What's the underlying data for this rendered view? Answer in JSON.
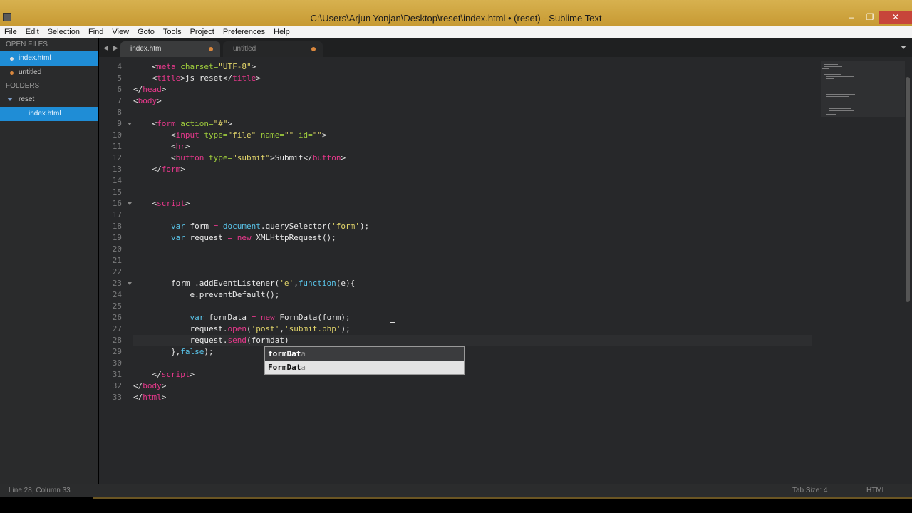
{
  "window": {
    "title": "C:\\Users\\Arjun Yonjan\\Desktop\\reset\\index.html • (reset) - Sublime Text",
    "minimize": "‒",
    "maximize": "❐",
    "close": "✕"
  },
  "menu": [
    "File",
    "Edit",
    "Selection",
    "Find",
    "View",
    "Goto",
    "Tools",
    "Project",
    "Preferences",
    "Help"
  ],
  "sidebar": {
    "open_files_header": "OPEN FILES",
    "open_files": [
      "index.html",
      "untitled"
    ],
    "folders_header": "FOLDERS",
    "folder": "reset",
    "folder_files": [
      "index.html"
    ]
  },
  "tabs": [
    "index.html",
    "untitled"
  ],
  "tab_nav": {
    "left": "◀",
    "right": "▶"
  },
  "code": {
    "line_numbers": [
      "4",
      "5",
      "6",
      "7",
      "8",
      "9",
      "10",
      "11",
      "12",
      "13",
      "14",
      "15",
      "16",
      "17",
      "18",
      "19",
      "20",
      "21",
      "22",
      "23",
      "24",
      "25",
      "26",
      "27",
      "28",
      "29",
      "30",
      "31",
      "32",
      "33"
    ],
    "l4": {
      "indent": "    ",
      "lt": "<",
      "tag": "meta",
      "attr": " charset=",
      "val": "\"UTF-8\"",
      "gt": ">"
    },
    "l5": {
      "indent": "    ",
      "lt": "<",
      "tag": "title",
      "gt": ">",
      "text": "js reset",
      "lt2": "</",
      "tag2": "title",
      "gt2": ">"
    },
    "l6": {
      "lt": "</",
      "tag": "head",
      "gt": ">"
    },
    "l7": {
      "lt": "<",
      "tag": "body",
      "gt": ">"
    },
    "l9": {
      "indent": "    ",
      "lt": "<",
      "tag": "form",
      "attr": " action=",
      "val": "\"#\"",
      "gt": ">"
    },
    "l10": {
      "indent": "        ",
      "lt": "<",
      "tag": "input",
      "attr1": " type=",
      "val1": "\"file\"",
      "attr2": " name=",
      "val2": "\"\"",
      "attr3": " id=",
      "val3": "\"\"",
      "gt": ">"
    },
    "l11": {
      "indent": "        ",
      "lt": "<",
      "tag": "hr",
      "gt": ">"
    },
    "l12": {
      "indent": "        ",
      "lt": "<",
      "tag": "button",
      "attr": " type=",
      "val": "\"submit\"",
      "gt": ">",
      "text": "Submit",
      "lt2": "</",
      "tag2": "button",
      "gt2": ">"
    },
    "l13": {
      "indent": "    ",
      "lt": "</",
      "tag": "form",
      "gt": ">"
    },
    "l16": {
      "indent": "    ",
      "lt": "<",
      "tag": "script",
      "gt": ">"
    },
    "l18": {
      "indent": "        ",
      "kw": "var",
      "a": " form ",
      "op": "=",
      "b": " ",
      "obj": "document",
      "c": ".querySelector(",
      "s": "'form'",
      "d": ");"
    },
    "l19": {
      "indent": "        ",
      "kw": "var",
      "a": " request ",
      "op": "=",
      "b": " ",
      "kw2": "new",
      "c": " ",
      "cls": "XMLHttpRequest",
      "d": "();"
    },
    "l23": {
      "indent": "        ",
      "a": "form .addEventListener(",
      "s": "'e'",
      "b": ",",
      "fn": "function",
      "c": "(e){"
    },
    "l24": {
      "indent": "            ",
      "a": "e.preventDefault();"
    },
    "l26": {
      "indent": "            ",
      "kw": "var",
      "a": " formData ",
      "op": "=",
      "b": " ",
      "kw2": "new",
      "c": " FormData(form);"
    },
    "l27": {
      "indent": "            ",
      "a": "request.",
      "m": "open",
      "b": "(",
      "s1": "'post'",
      "c": ",",
      "s2": "'submit.php'",
      "d": ");"
    },
    "l28": {
      "indent": "            ",
      "a": "request.",
      "m": "send",
      "b": "(formdat)"
    },
    "l29": {
      "indent": "        ",
      "a": "},",
      "kw": "false",
      "b": ");"
    },
    "l31": {
      "indent": "    ",
      "lt": "</",
      "tag": "script",
      "gt": ">"
    },
    "l32": {
      "lt": "</",
      "tag": "body",
      "gt": ">"
    },
    "l33": {
      "lt": "</",
      "tag": "html",
      "gt": ">"
    }
  },
  "autocomplete": [
    {
      "match": "formDat",
      "rest": "a"
    },
    {
      "match": "FormDat",
      "rest": "a"
    }
  ],
  "status": {
    "position": "Line 28, Column 33",
    "tab_size": "Tab Size: 4",
    "syntax": "HTML"
  },
  "colors": {
    "title_bar": "#c9a13a",
    "sidebar_selected": "#1f8dd6",
    "editor_bg": "#27282a",
    "tag": "#e6388b",
    "attribute": "#9ecb3c",
    "string": "#e1d46a",
    "function": "#59c3e8"
  }
}
